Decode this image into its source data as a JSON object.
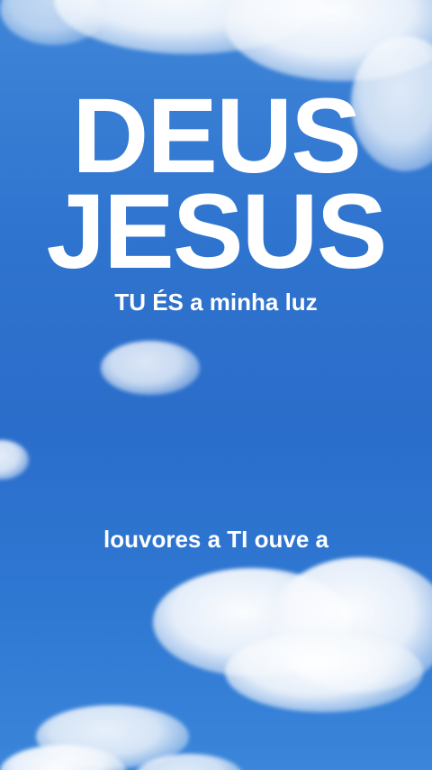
{
  "video": {
    "title_line_1": "DEUS",
    "title_line_2": "JESUS",
    "subtitle": "TU ÉS a minha luz",
    "lyric": "louvores a TI ouve a"
  },
  "colors": {
    "sky_top": "#3f86d8",
    "sky_mid": "#2a6dca",
    "text": "#ffffff"
  }
}
